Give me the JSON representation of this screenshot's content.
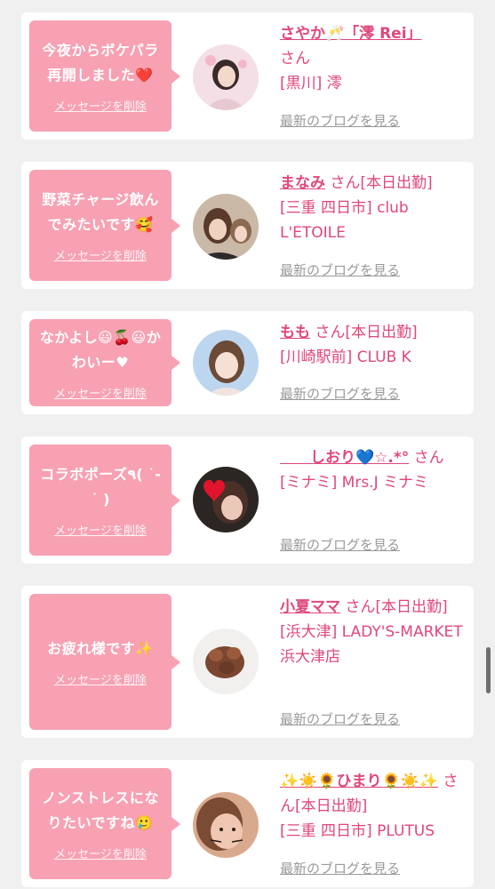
{
  "items": [
    {
      "message": "今夜からボケパラ再開しました❤️",
      "delete_label": "メッセージを削除",
      "name": "さやか🥂「澪 Rei」",
      "suffix": "さん",
      "location": "[黒川] 澪",
      "blog_label": "最新のブログを見る"
    },
    {
      "message": "野菜チャージ飲んでみたいです🥰",
      "delete_label": "メッセージを削除",
      "name": "まなみ",
      "suffix": "さん[本日出勤]",
      "location": "[三重 四日市] club L'ETOILE",
      "blog_label": "最新のブログを見る"
    },
    {
      "message": "なかよし😃🍒😃かわいー♥",
      "delete_label": "メッセージを削除",
      "name": "もも",
      "suffix": "さん[本日出勤]",
      "location": "[川崎駅前] CLUB K",
      "blog_label": "最新のブログを見る"
    },
    {
      "message": "コラボポーズ٩( ˙-˙ )",
      "delete_label": "メッセージを削除",
      "name": "　　しおり💙☆.*°",
      "suffix": "さん",
      "location": "[ミナミ] Mrs.J ミナミ",
      "blog_label": "最新のブログを見る"
    },
    {
      "message": "お疲れ様です✨",
      "delete_label": "メッセージを削除",
      "name": "小夏ママ",
      "suffix": "さん[本日出勤]",
      "location": "[浜大津] LADY'S-MARKET 浜大津店",
      "blog_label": "最新のブログを見る"
    },
    {
      "message": "ノンストレスになりたいですね🥲",
      "delete_label": "メッセージを削除",
      "name": "✨☀️🌻ひまり🌻☀️✨",
      "suffix": "さん[本日出勤]",
      "location": "[三重 四日市] PLUTUS",
      "blog_label": "最新のブログを見る"
    }
  ],
  "colors": {
    "bubble": "#f7a1b3",
    "accent": "#e0477a",
    "muted": "#9a9a9a",
    "page_bg": "#f0f0f0"
  },
  "icons": [
    "avatar-photo",
    "scrollbar-thumb"
  ]
}
